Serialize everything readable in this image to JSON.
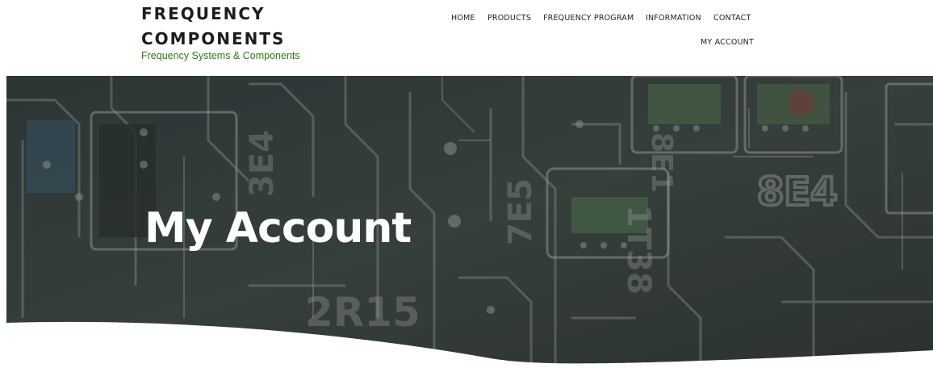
{
  "site": {
    "logo_line1": "FREQUENCY",
    "logo_line2": "COMPONENTS",
    "tagline": "Frequency Systems & Components"
  },
  "nav": {
    "items": [
      {
        "label": "HOME"
      },
      {
        "label": "PRODUCTS"
      },
      {
        "label": "FREQUENCY PROGRAM"
      },
      {
        "label": "INFORMATION"
      },
      {
        "label": "CONTACT"
      },
      {
        "label": "MY ACCOUNT"
      }
    ]
  },
  "hero": {
    "title": "My Account",
    "board_labels": [
      "8E4",
      "7E5",
      "2R15",
      "3E4",
      "1T38",
      "8E1"
    ]
  },
  "colors": {
    "logo_text": "#1c1c22",
    "tagline": "#2f7a16",
    "hero_overlay": "#3a4340",
    "hero_title": "#ffffff"
  }
}
